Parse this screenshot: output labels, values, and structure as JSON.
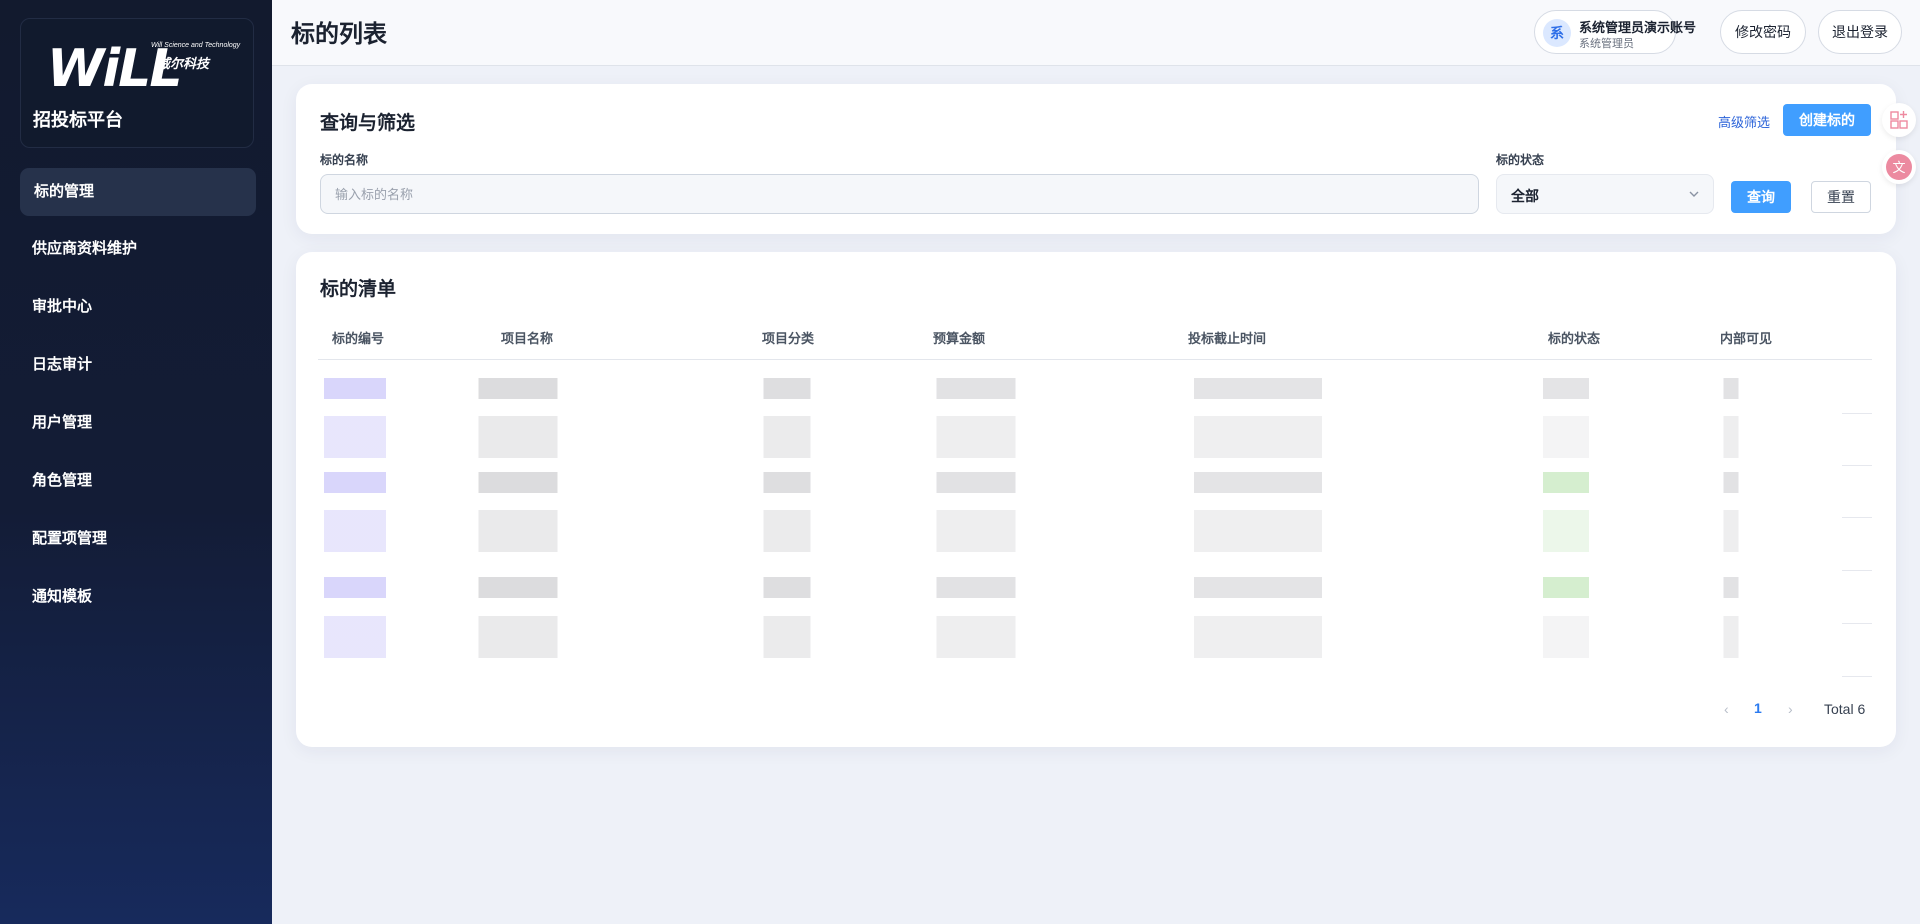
{
  "sidebar": {
    "brand": {
      "logo_text": "WiLL",
      "logo_sub": "Will Science and Technology",
      "logo_cn": "威尔科技",
      "platform": "招投标平台"
    },
    "items": [
      {
        "label": "标的管理",
        "active": true
      },
      {
        "label": "供应商资料维护"
      },
      {
        "label": "审批中心"
      },
      {
        "label": "日志审计"
      },
      {
        "label": "用户管理"
      },
      {
        "label": "角色管理"
      },
      {
        "label": "配置项管理"
      },
      {
        "label": "通知模板"
      }
    ]
  },
  "header": {
    "title": "标的列表",
    "user": {
      "avatar": "系",
      "name": "系统管理员演示账号",
      "role": "系统管理员"
    },
    "change_password": "修改密码",
    "logout": "退出登录"
  },
  "filter": {
    "title": "查询与筛选",
    "advanced": "高级筛选",
    "create": "创建标的",
    "name_label": "标的名称",
    "name_placeholder": "输入标的名称",
    "name_value": "",
    "status_label": "标的状态",
    "status_value": "全部",
    "query": "查询",
    "reset": "重置"
  },
  "table": {
    "title": "标的清单",
    "columns": [
      "标的编号",
      "项目名称",
      "项目分类",
      "预算金额",
      "投标截止时间",
      "标的状态",
      "内部可见"
    ],
    "rows_count_note": "6 rows, contents pixelated"
  },
  "pagination": {
    "prev": "‹",
    "current": "1",
    "next": "›",
    "total": "Total 6"
  },
  "colors": {
    "accent": "#409eff",
    "sidebar_bg": "#121a2e",
    "link": "#2b63d9"
  },
  "icons": {
    "chevron": "chevron-down-icon",
    "apps": "apps-add-icon",
    "translate": "translate-icon"
  }
}
